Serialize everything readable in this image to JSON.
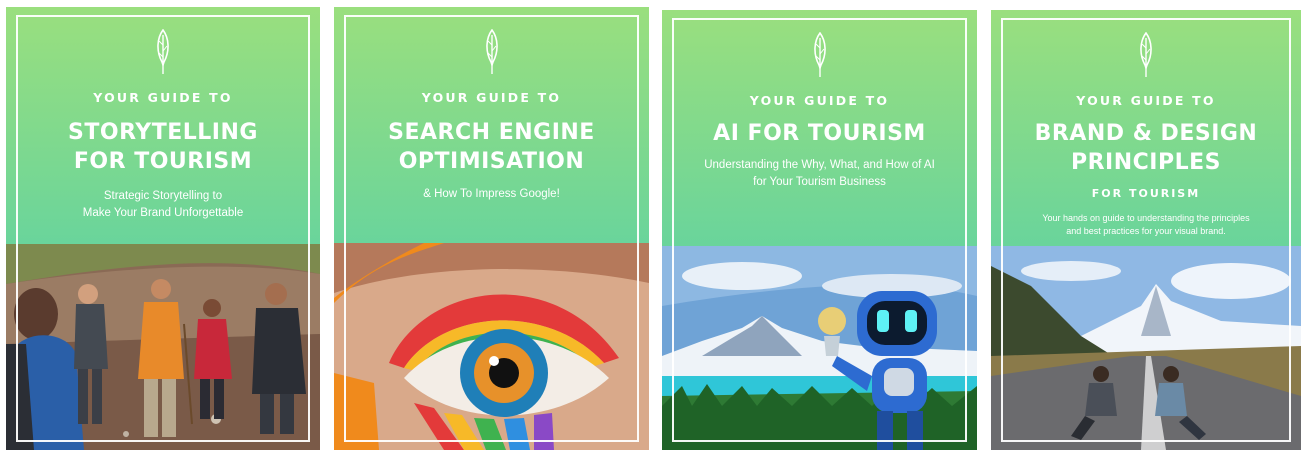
{
  "covers": [
    {
      "kicker": "YOUR GUIDE TO",
      "title_line1": "STORYTELLING",
      "title_line2": "FOR TOURISM",
      "subtitle_line1": "Strategic Storytelling to",
      "subtitle_line2": "Make Your Brand Unforgettable",
      "icon": "feather-icon",
      "photo": "hikers-group-photo"
    },
    {
      "kicker": "YOUR GUIDE TO",
      "title_line1": "SEARCH ENGINE",
      "title_line2": "OPTIMISATION",
      "subtitle_line1": "& How To Impress Google!",
      "icon": "feather-icon",
      "photo": "rainbow-eye-photo"
    },
    {
      "kicker": "YOUR GUIDE TO",
      "title_line1": "AI FOR TOURISM",
      "subtitle_line1": "Understanding the Why, What, and How of AI",
      "subtitle_line2": "for Your Tourism Business",
      "icon": "feather-icon",
      "photo": "robot-mountain-lake-photo"
    },
    {
      "kicker": "YOUR GUIDE TO",
      "title_line1": "BRAND & DESIGN",
      "title_line2": "PRINCIPLES",
      "subkicker": "FOR TOURISM",
      "subtitle_line1": "Your hands on guide to understanding the principles",
      "subtitle_line2": "and best practices for your visual brand.",
      "icon": "feather-icon",
      "photo": "road-mountain-couple-photo"
    }
  ],
  "colors": {
    "gradient_top": "#9adf7e",
    "gradient_bottom": "#4fcea6",
    "text": "#ffffff"
  }
}
